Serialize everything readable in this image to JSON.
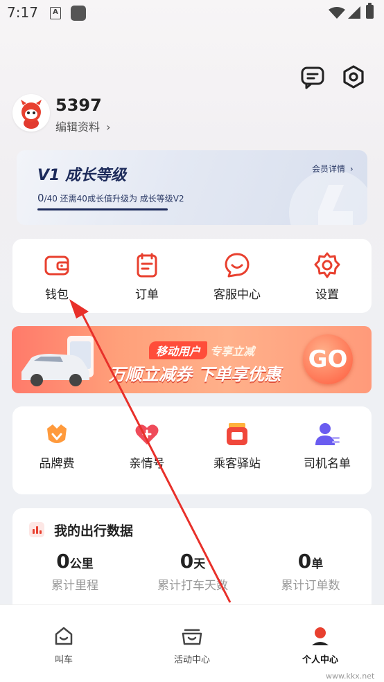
{
  "status_bar": {
    "time": "7:17",
    "notif_label": "A"
  },
  "profile": {
    "username": "5397",
    "edit_label": "编辑资料",
    "edit_chevron": "›"
  },
  "level_card": {
    "title": "V1 成长等级",
    "detail_label": "会员详情",
    "detail_chevron": "›",
    "progress_current": "0",
    "progress_text": "/40 还需40成长值升级为 成长等级V2"
  },
  "quick_menu": [
    {
      "label": "钱包",
      "icon": "wallet-icon"
    },
    {
      "label": "订单",
      "icon": "order-icon"
    },
    {
      "label": "客服中心",
      "icon": "customer-service-icon"
    },
    {
      "label": "设置",
      "icon": "settings-icon"
    }
  ],
  "banner": {
    "tag_text": "移动用户",
    "tag_suffix": "专享立减",
    "headline": "万顺立减券 下单享优惠",
    "go_label": "GO"
  },
  "services": [
    {
      "label": "品牌费",
      "icon": "brand-fee-icon"
    },
    {
      "label": "亲情号",
      "icon": "family-number-icon"
    },
    {
      "label": "乘客驿站",
      "icon": "passenger-station-icon"
    },
    {
      "label": "司机名单",
      "icon": "driver-list-icon"
    }
  ],
  "travel_stats": {
    "title": "我的出行数据",
    "items": [
      {
        "value": "0",
        "unit": "公里",
        "label": "累计里程"
      },
      {
        "value": "0",
        "unit": "天",
        "label": "累计打车天数"
      },
      {
        "value": "0",
        "unit": "单",
        "label": "累计订单数"
      }
    ]
  },
  "bottom_tabs": [
    {
      "label": "叫车",
      "icon": "home-icon",
      "active": false
    },
    {
      "label": "活动中心",
      "icon": "activity-icon",
      "active": false
    },
    {
      "label": "个人中心",
      "icon": "profile-icon",
      "active": true
    }
  ],
  "watermark": {
    "text": "www.kkx.net"
  },
  "colors": {
    "accent": "#e8402f",
    "text": "#222222",
    "muted": "#999999"
  }
}
